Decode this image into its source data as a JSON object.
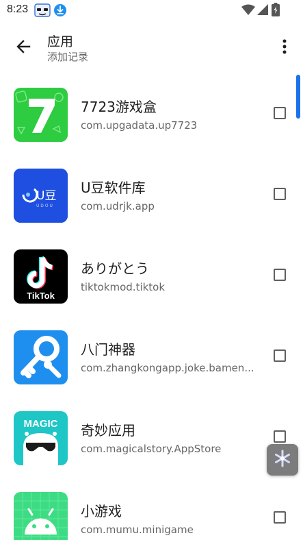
{
  "status_bar": {
    "time": "8:23",
    "icons": [
      "notification-app-icon",
      "download-icon",
      "wifi-icon",
      "signal-icon",
      "battery-icon"
    ]
  },
  "app_bar": {
    "title": "应用",
    "subtitle": "添加记录",
    "back_icon": "arrow-back-icon",
    "menu_icon": "more-vert-icon"
  },
  "apps": [
    {
      "name": "7723游戏盒",
      "package": "com.upgadata.up7723",
      "checked": false,
      "icon": "7723-app-icon"
    },
    {
      "name": "U豆软件库",
      "package": "com.udrjk.app",
      "checked": false,
      "icon": "udou-app-icon"
    },
    {
      "name": "ありがとう",
      "package": "tiktokmod.tiktok",
      "checked": false,
      "icon": "tiktok-app-icon"
    },
    {
      "name": "八门神器",
      "package": "com.zhangkongapp.joke.bamen...",
      "checked": false,
      "icon": "bamen-app-icon"
    },
    {
      "name": "奇妙应用",
      "package": "com.magicalstory.AppStore",
      "checked": false,
      "icon": "magic-app-icon"
    },
    {
      "name": "小游戏",
      "package": "com.mumu.minigame",
      "checked": false,
      "icon": "android-app-icon"
    }
  ],
  "icon_text": {
    "udou": "U豆",
    "udou_sub": "U D O U",
    "tiktok": "TikTok",
    "magic": "MAGIC"
  },
  "colors": {
    "accent": "#1a73e8",
    "icon_7723": "#2ecc40",
    "icon_udou": "#1e4fe0",
    "icon_tiktok": "#000000",
    "icon_bamen": "#1e8fef",
    "icon_magic": "#1fc6c6",
    "icon_android": "#3ddc84"
  }
}
